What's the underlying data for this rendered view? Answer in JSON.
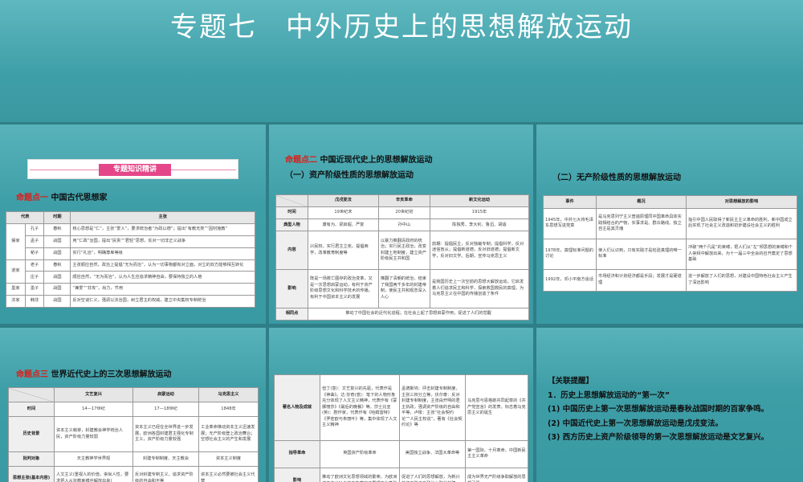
{
  "title": "专题七　中外历史上的思想解放运动",
  "p1": {
    "banner": "专题知识精讲",
    "h_red": "命题点一",
    "h": "中国古代思想家",
    "headers": [
      "代表",
      "时期",
      "主张"
    ],
    "rows": [
      {
        "school": "儒家",
        "name": "孔子",
        "period": "春秋",
        "idea": "核心思想是“仁”，主张“爱人”，要求统治者“为政以德”；提出“有教无类”“因材施教”"
      },
      {
        "name": "孟子",
        "period": "战国",
        "idea": "用“仁政”治国，提出“民贵”“君轻”思想，反对一切非正义战争"
      },
      {
        "name": "荀子",
        "period": "战国",
        "idea": "实行“礼治”，明确尊卑等级"
      },
      {
        "school": "道家",
        "name": "老子",
        "period": "春秋",
        "idea": "主张顺应自然，政治上提倡“无为而治”，认为一切事物都有对立面，对立的双方能够相互转化"
      },
      {
        "name": "庄子",
        "period": "战国",
        "idea": "顺应自然，“无为而治”，认为人生应追求精神自由，要保持独立的人格"
      },
      {
        "school": "墨家",
        "name": "墨子",
        "period": "战国",
        "idea": "“兼爱”“非攻”，尚力，节用"
      },
      {
        "school": "法家",
        "name": "韩非",
        "period": "战国",
        "idea": "反对空谈仁义，强调以法治国，树立君主的权威，建立中央集权专制统治"
      }
    ]
  },
  "p2": {
    "h_red": "命题点二",
    "h": "中国近现代史上的思想解放运动",
    "sub": "（一）资产阶级性质的思想解放运动",
    "headers": [
      "戊戌变法",
      "辛亥革命",
      "新文化运动"
    ],
    "rows": [
      {
        "label": "时间",
        "cells": [
          "19世纪末",
          "20世纪初",
          "1915年"
        ]
      },
      {
        "label": "典型人物",
        "cells": [
          "康有为、梁启超、严复",
          "孙中山",
          "陈独秀、李大钊、鲁迅、胡适"
        ]
      },
      {
        "label": "内容",
        "cells": [
          "兴民权，实行君主立宪，提倡西学，改革教育制度等",
          "以暴力推翻清政府的统治；实行民主政治；改变封建土地制度，建立资产阶级民主共和国",
          "前期：提倡民主，反对独裁专制；提倡科学，反对迷信盲从；提倡新道德，反对旧道德；提倡新文学，反对旧文学。后期，宣传马克思主义"
        ]
      },
      {
        "label": "影响",
        "cells": [
          "既是一场救亡图存的政治变革，又是一次思想启蒙运动，有利于资产阶级思想文化和科学技术的传播，有利于中国资本主义的发展",
          "推翻了清朝的统治，结束了我国两千多年的封建帝制，使民主共和观念深入人心",
          "是我国历史上一次空前的思想大解放运动，它启发着人们追求民主和科学，探索救国救民的真理，为马克思主义在中国的传播创造了条件"
        ]
      },
      {
        "label": "相同点",
        "cells": [
          "推动了中国社会的近代化进程；在社会上起了思想启蒙作用，促进了人们的觉醒"
        ]
      }
    ]
  },
  "p3": {
    "sub": "（二）无产阶级性质的思想解放运动",
    "headers": [
      "事件",
      "概况",
      "对思想解放的影响"
    ],
    "rows": [
      [
        "1945年，中共七大将毛泽东思想写进党章",
        "是马克思列宁主义普遍原理同中国革命具体实践相结合的产物，实事求是、群众路线、独立自主是其灵魂",
        "指引中国人民取得了新民主主义革命的胜利，新中国成立后实现了社会主义改造和初步建设社会主义的胜利"
      ],
      [
        "1978年，真理标准问题的讨论",
        "使人们认识到，只有实践才是检验真理的唯一标准",
        "冲破“两个凡是”的束缚，把人们从“左”倾思想的束缚和个人崇拜中解放出来，为十一届三中全会的召开奠定了思想基础"
      ],
      [
        "1992年，邓小平南方谈话",
        "市场经济和计划经济都是手段；发展才是硬道理",
        "进一步解放了人们的思想，对建设中国特色社会主义产生了深远影响"
      ]
    ]
  },
  "p4": {
    "h_red": "命题点三",
    "h": "世界近代史上的三次思想解放运动",
    "headers": [
      "文艺复兴",
      "启蒙运动",
      "马克思主义"
    ],
    "rows": [
      {
        "label": "时间",
        "cells": [
          "14—17世纪",
          "17—18世纪",
          "1848年"
        ]
      },
      {
        "label": "历史背景",
        "cells": [
          "资本主义萌芽，封建教会神学统治人民，资产阶级力量较弱",
          "资本主义已经在全世界进一步发展，欧洲各国封建君主强化专制主义，资产阶级力量较强",
          "工业革命推动资本主义迅速发展；无产阶级登上政治舞台；空想社会主义的产生和发展"
        ]
      },
      {
        "label": "批判对象",
        "cells": [
          "天主教神学世界观",
          "封建专制制度、天主教会",
          "资本主义制度"
        ]
      },
      {
        "label": "思想主张(基本内容)",
        "cells": [
          "人文主义(重视人的价值，崇尚人性，要求把人从宗教束缚中解放出来)",
          "反对封建专制主义，追求资产阶级的自由和平等",
          "资本主义必然要被社会主义代替"
        ]
      }
    ]
  },
  "p5": {
    "rows": [
      {
        "label": "著名人物及成就",
        "cells": [
          "但丁(意)：文艺复兴的先驱，代表作是《神曲》。达·芬奇(意)：笔下的人物形象充分体现了人文主义精神，代表作有《蒙娜丽莎》《最后的晚餐》等。莎士比亚(英)：剧作家，代表作有《哈姆雷特》《罗密欧与朱丽叶》等，集中体现了人文主义精神",
          "孟德斯鸠：抨击封建专制制度，主张三权分立等。伏尔泰：反对封建专制制度，主张由开明的君主执政，强调资产阶级的自由和平等。卢梭：主张“社会契约论”“人民主权说”，著有《社会契约论》等",
          "马克思与恩格斯共同起草的《共产党宣言》的发表，标志着马克思主义的诞生"
        ]
      },
      {
        "label": "指导革命",
        "cells": [
          "英国资产阶级革命",
          "美国独立战争、法国大革命等",
          "第一国际、十月革命、中国新民主主义革命"
        ]
      },
      {
        "label": "影响",
        "cells": [
          "推动了欧洲文化思想领域的繁荣，为欧洲资本主义社会的产生奠定了思想文化基础",
          "促进了人们的思想解放，为新兴的资产阶级在政治上取代封建",
          "成为世界无产阶级争取解放的思想武器"
        ]
      }
    ]
  },
  "p6": {
    "lines": [
      "【关联提醒】",
      "1．历史上思想解放运动的“第一次”",
      "(1) 中国历史上第一次思想解放运动是春秋战国时期的百家争鸣。",
      "(2) 中国近代史上第一次思想解放运动是戊戌变法。",
      "(3) 西方历史上资产阶级领导的第一次思想解放运动是文艺复兴。"
    ]
  }
}
